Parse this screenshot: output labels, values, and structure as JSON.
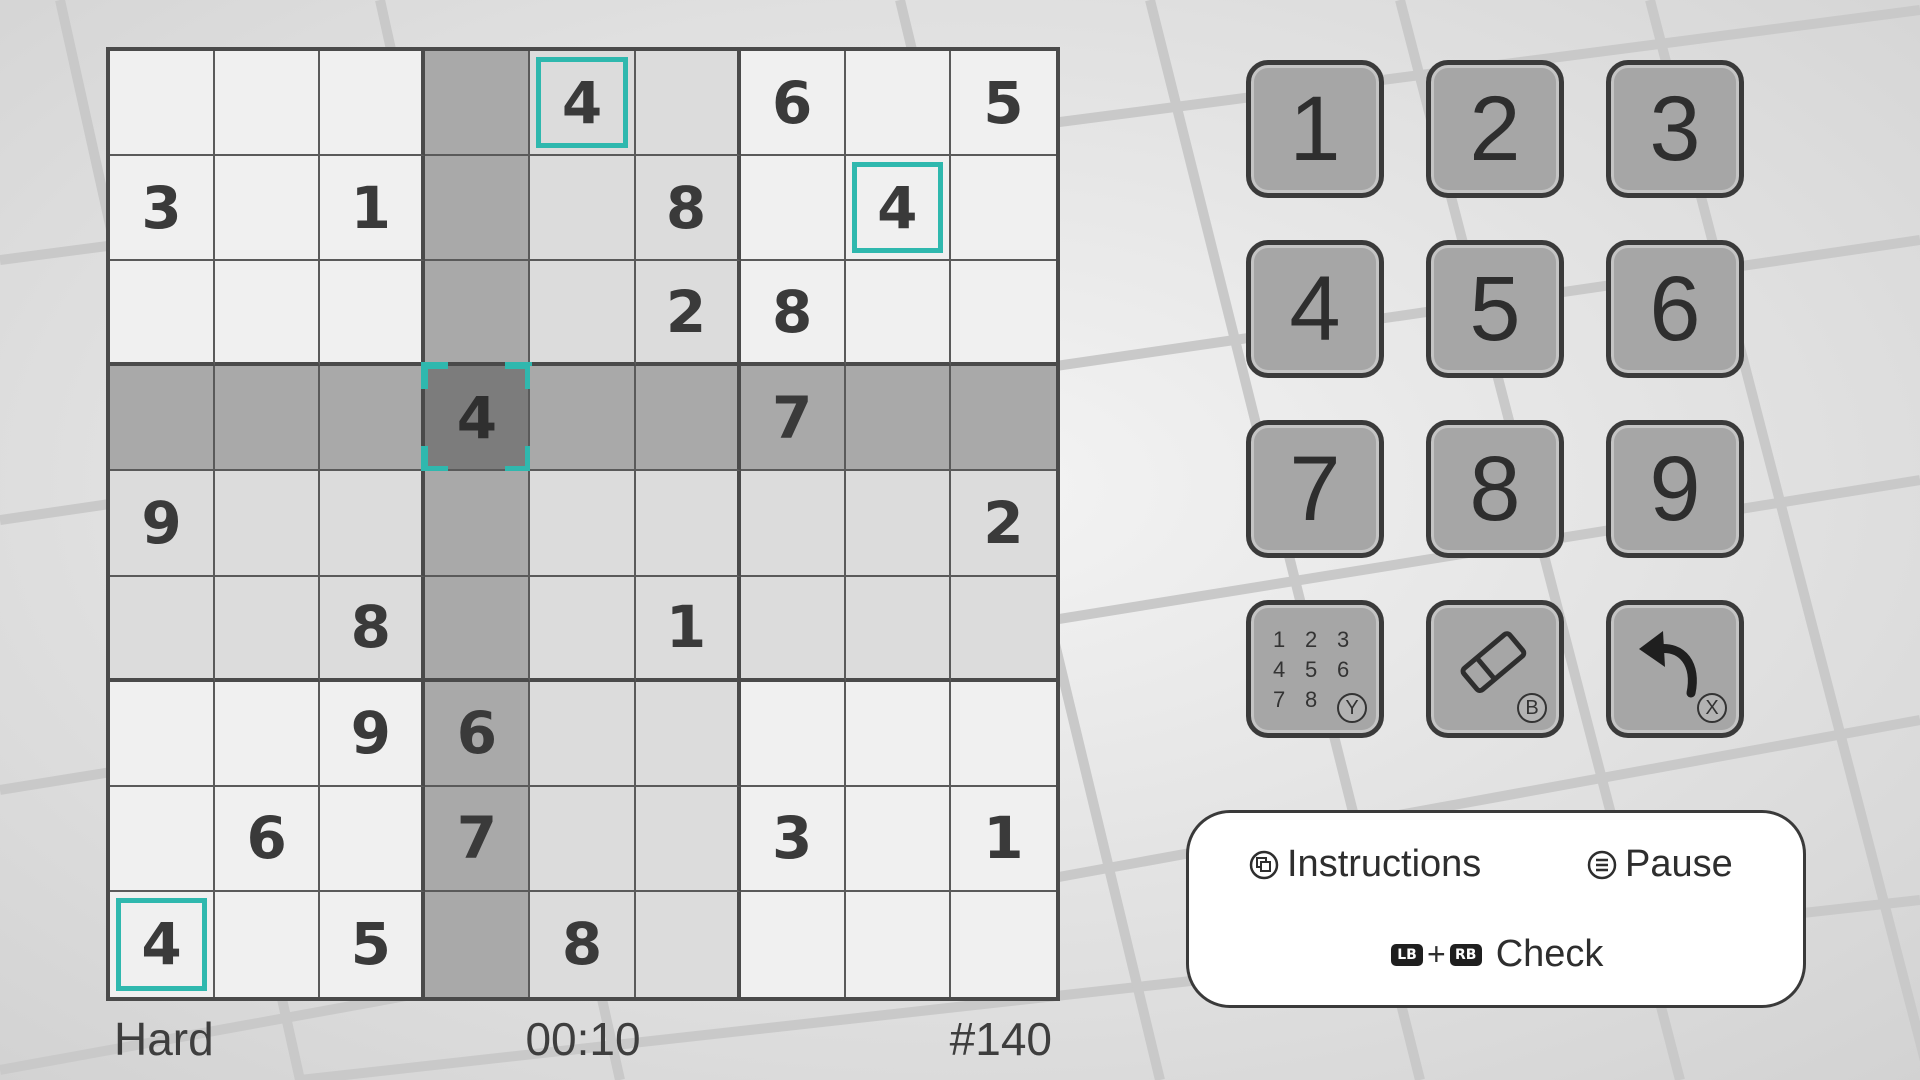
{
  "board": {
    "cells": [
      [
        "",
        "",
        "",
        "",
        "4",
        "",
        "6",
        "",
        "5"
      ],
      [
        "3",
        "",
        "1",
        "",
        "",
        "8",
        "",
        "4",
        ""
      ],
      [
        "",
        "",
        "",
        "",
        "",
        "2",
        "8",
        "",
        ""
      ],
      [
        "",
        "",
        "",
        "4",
        "",
        "",
        "7",
        "",
        ""
      ],
      [
        "9",
        "",
        "",
        "",
        "",
        "",
        "",
        "",
        "2"
      ],
      [
        "",
        "",
        "8",
        "",
        "",
        "1",
        "",
        "",
        ""
      ],
      [
        "",
        "",
        "9",
        "6",
        "",
        "",
        "",
        "",
        ""
      ],
      [
        "",
        "6",
        "",
        "7",
        "",
        "",
        "3",
        "",
        "1"
      ],
      [
        "4",
        "",
        "5",
        "",
        "8",
        "",
        "",
        "",
        ""
      ]
    ],
    "selected": [
      3,
      3
    ],
    "matching_highlights": [
      [
        0,
        4
      ],
      [
        1,
        7
      ],
      [
        8,
        0
      ]
    ]
  },
  "status": {
    "difficulty": "Hard",
    "timer": "00:10",
    "puzzle_number": "#140"
  },
  "keypad": {
    "digits": [
      "1",
      "2",
      "3",
      "4",
      "5",
      "6",
      "7",
      "8",
      "9"
    ],
    "notes": {
      "digits": [
        "1",
        "2",
        "3",
        "4",
        "5",
        "6",
        "7",
        "8"
      ],
      "button_hint": "Y"
    },
    "erase": {
      "icon": "eraser-icon",
      "button_hint": "B"
    },
    "undo": {
      "icon": "undo-arrow-icon",
      "button_hint": "X"
    }
  },
  "controls": {
    "instructions": "Instructions",
    "pause": "Pause",
    "check_lb": "LB",
    "check_plus": "+",
    "check_rb": "RB",
    "check": "Check"
  },
  "colors": {
    "highlight": "#2fb8ae",
    "line_shade": "#a9a9a9",
    "box_shade": "#dcdcdc",
    "selected_cell": "#7c7c7c",
    "cell": "#f0f0f0"
  }
}
